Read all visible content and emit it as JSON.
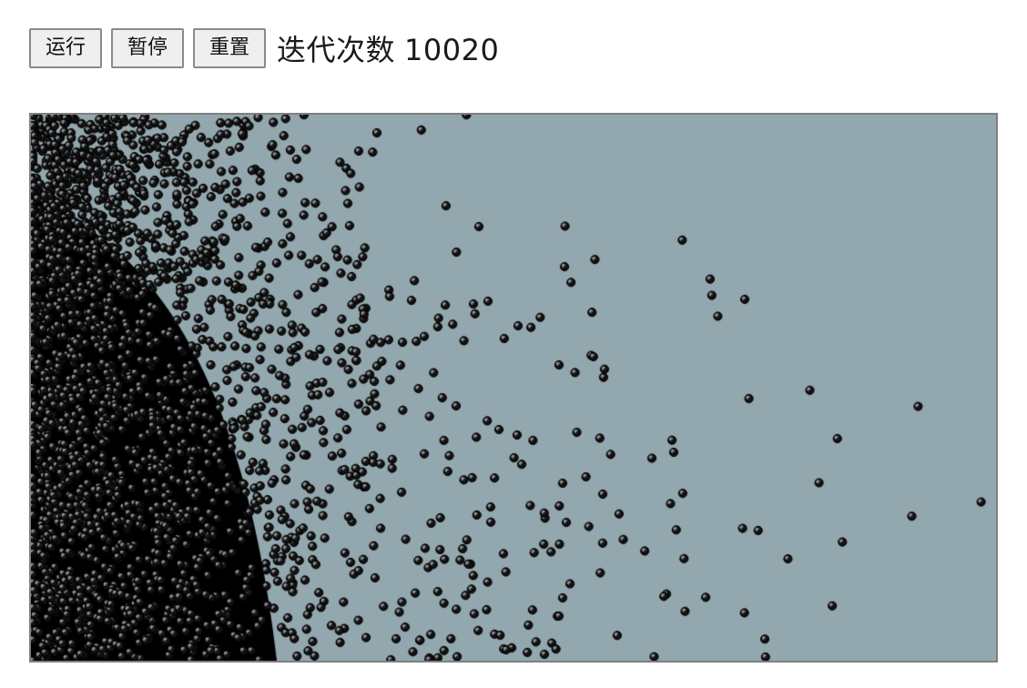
{
  "toolbar": {
    "run_label": "运行",
    "pause_label": "暂停",
    "reset_label": "重置",
    "iteration_label": "迭代次数",
    "iteration_count": "10020"
  },
  "simulation": {
    "background_color": "#93a7ae",
    "particle_color": "#000000",
    "particle_highlight_color": "#8a8f91"
  }
}
